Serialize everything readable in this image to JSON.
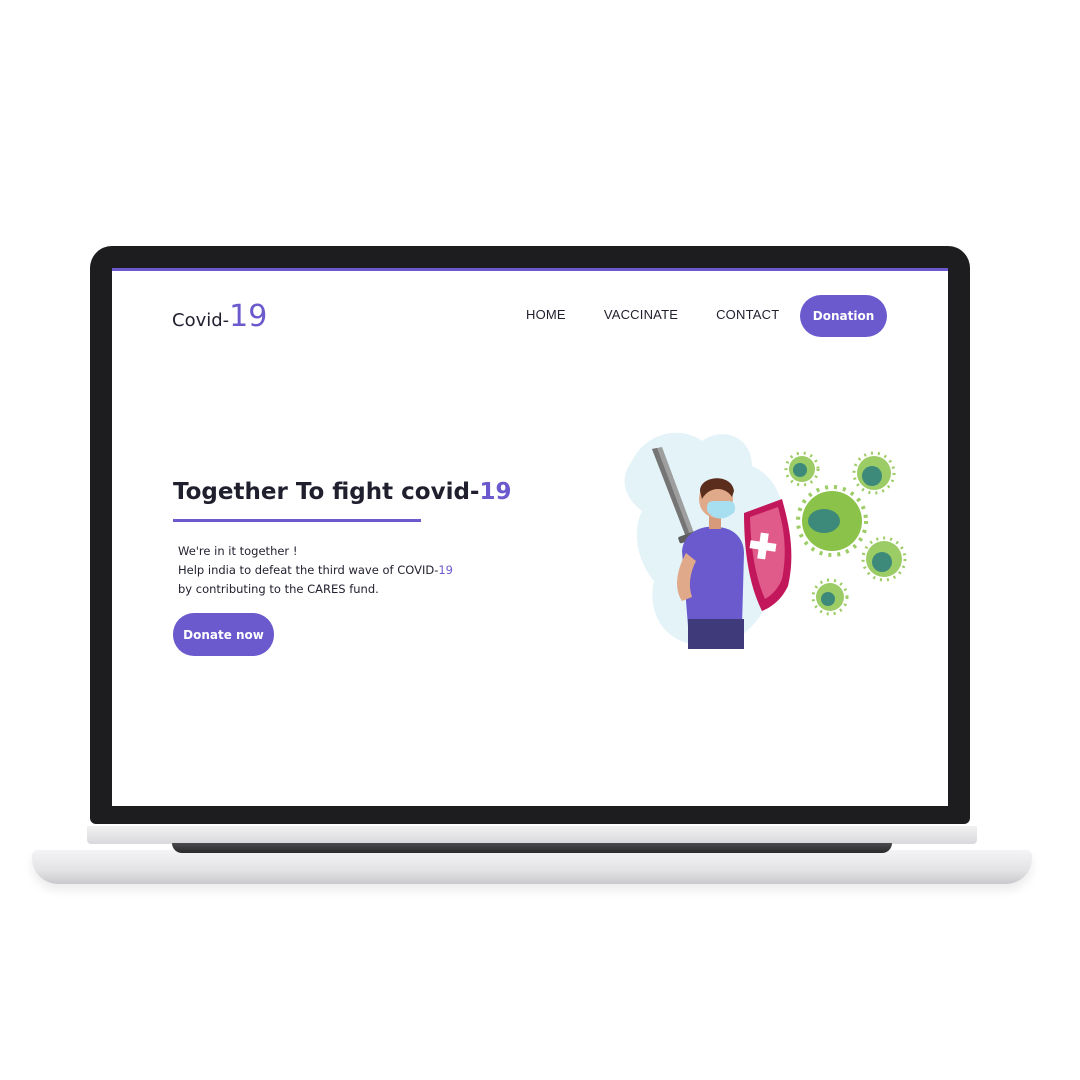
{
  "header": {
    "logo_text": "Covid-",
    "logo_number": "19",
    "nav": [
      {
        "label": "HOME"
      },
      {
        "label": "VACCINATE"
      },
      {
        "label": "CONTACT"
      }
    ],
    "donation_label": "Donation"
  },
  "hero": {
    "title_text": "Together To fight covid-",
    "title_number": "19",
    "line1": "We're in it together !",
    "line2_text": "Help india to defeat the third wave of COVID-",
    "line2_number": "19",
    "line3": "by contributing to the CARES fund.",
    "donate_label": "Donate now"
  },
  "icons": {
    "illustration": "person-with-sword-and-shield-vs-virus-illustration"
  },
  "colors": {
    "accent": "#6a5acd",
    "text": "#1f1f2e",
    "shield": "#c2185b",
    "virus": "#8bc34a"
  }
}
